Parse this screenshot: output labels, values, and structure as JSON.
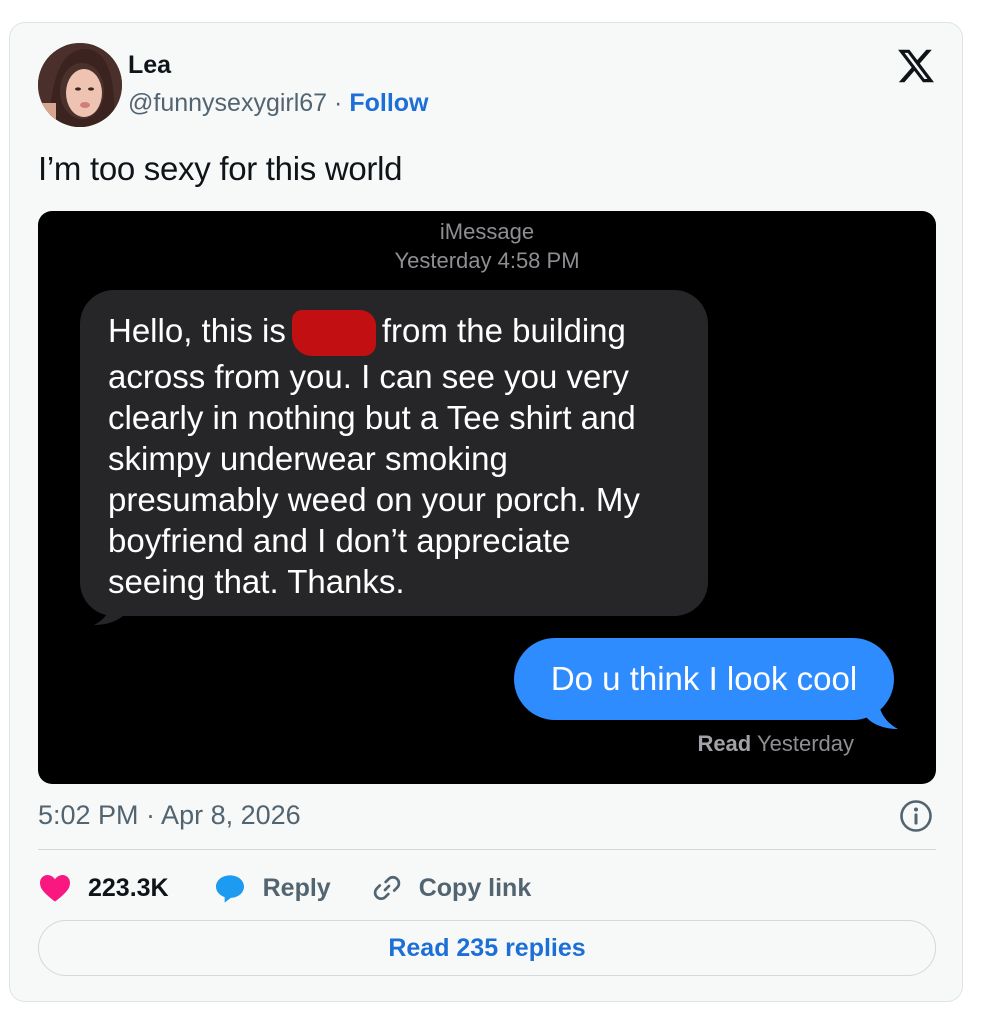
{
  "tweet": {
    "author_name": "Lea",
    "handle": "@funnysexygirl67",
    "separator": "·",
    "follow_label": "Follow",
    "text": "I’m too sexy for this world",
    "timestamp": "5:02 PM · Apr 8, 2026"
  },
  "screenshot": {
    "service": "iMessage",
    "date_time": "Yesterday 4:58 PM",
    "incoming_message": {
      "line1_before": "Hello, this is",
      "line1_after": "from the building",
      "lines": [
        "across from you. I can see you very",
        "clearly in nothing but a Tee shirt and",
        "skimpy underwear smoking",
        "presumably weed on your porch. My",
        "boyfriend and I don’t appreciate",
        "seeing that. Thanks."
      ]
    },
    "outgoing_message": "Do u think I look cool",
    "read_label": "Read",
    "read_time": "Yesterday"
  },
  "actions": {
    "likes": "223.3K",
    "reply_label": "Reply",
    "copy_link_label": "Copy link",
    "read_replies_label": "Read 235 replies"
  },
  "colors": {
    "like": "#f91880",
    "reply": "#1d9bf0",
    "follow": "#1d6fd6",
    "outgoing_bubble": "#2f8cff",
    "incoming_bubble": "#262628"
  },
  "icons": [
    "x-logo-icon",
    "info-icon",
    "heart-icon",
    "reply-bubble-icon",
    "link-icon"
  ]
}
